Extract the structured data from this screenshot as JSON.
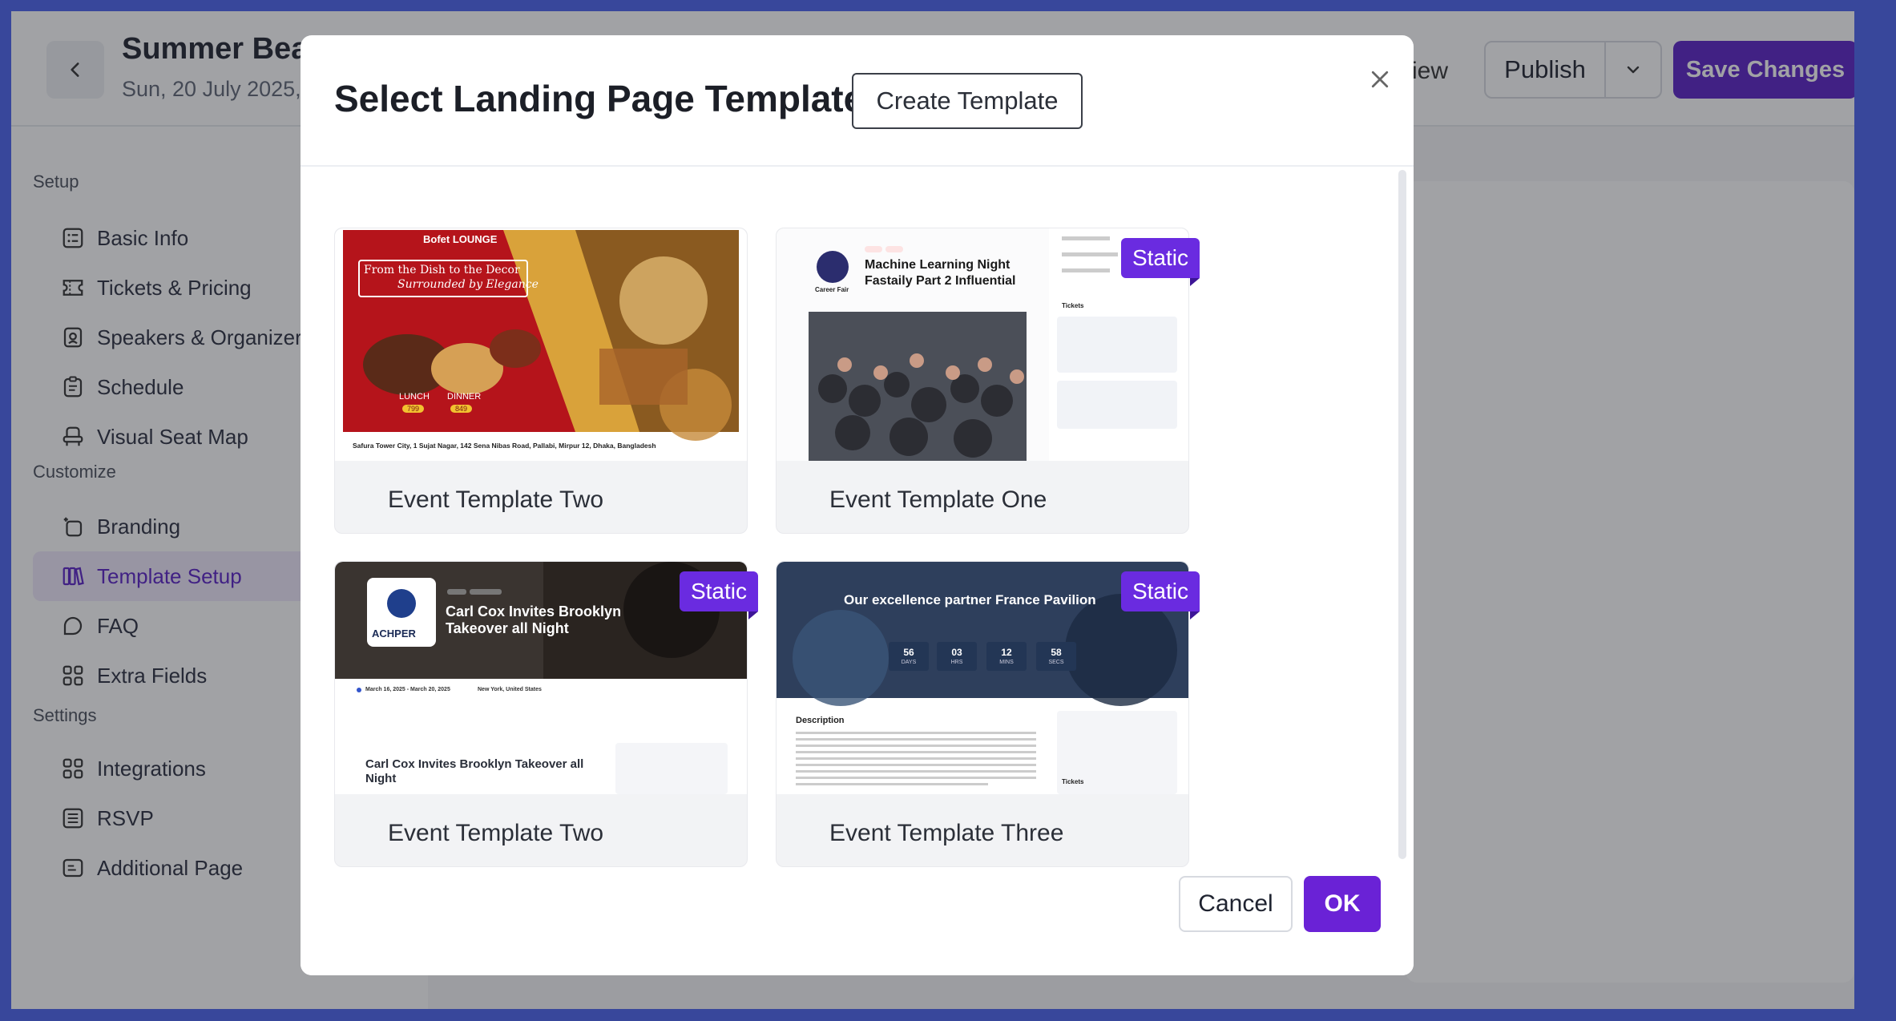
{
  "header": {
    "event_title": "Summer Bea",
    "event_date": "Sun, 20 July 2025,",
    "preview_label": "iew",
    "publish_label": "Publish",
    "save_label": "Save Changes"
  },
  "sidebar": {
    "sections": [
      {
        "label": "Setup",
        "items": [
          "Basic Info",
          "Tickets & Pricing",
          "Speakers & Organizers",
          "Schedule",
          "Visual Seat Map"
        ]
      },
      {
        "label": "Customize",
        "items": [
          "Branding",
          "Template Setup",
          "FAQ",
          "Extra Fields"
        ]
      },
      {
        "label": "Settings",
        "items": [
          "Integrations",
          "RSVP",
          "Additional Page"
        ]
      }
    ],
    "active_item": "Template Setup"
  },
  "modal": {
    "title": "Select Landing Page Template",
    "create_label": "Create Template",
    "cancel_label": "Cancel",
    "ok_label": "OK",
    "badge_label": "Static",
    "templates": [
      {
        "name": "Event Template Two",
        "static": false,
        "thumb": {
          "brand": "Bofet LOUNGE",
          "banner_line1": "From the Dish to the Decor",
          "banner_line2": "Surrounded by Elegance",
          "lunch": "LUNCH",
          "dinner": "DINNER",
          "lunch_price": "799",
          "dinner_price": "849",
          "address": "Safura Tower City, 1 Sujat Nagar, 142 Sena Nibas Road, Pallabi, Mirpur 12, Dhaka, Bangladesh"
        }
      },
      {
        "name": "Event Template One",
        "static": true,
        "thumb": {
          "heading": "Machine Learning Night Fastaily Part 2 Influential",
          "org": "Career Fair",
          "tickets": "Tickets"
        }
      },
      {
        "name": "Event Template Two",
        "static": true,
        "thumb": {
          "logo": "ACHPER",
          "heading": "Carl Cox Invites Brooklyn Takeover all Night",
          "dates": "March 16, 2025 - March 20, 2025",
          "location": "New York, United States",
          "subheading": "Carl Cox Invites Brooklyn Takeover all Night"
        }
      },
      {
        "name": "Event Template Three",
        "static": true,
        "thumb": {
          "heading": "Our excellence partner France Pavilion",
          "countdown": [
            {
              "value": "56",
              "unit": "DAYS"
            },
            {
              "value": "03",
              "unit": "HRS"
            },
            {
              "value": "12",
              "unit": "MINS"
            },
            {
              "value": "58",
              "unit": "SECS"
            }
          ],
          "description_title": "Description",
          "tickets": "Tickets"
        }
      }
    ]
  },
  "colors": {
    "brand_purple": "#5a22c7",
    "badge_purple": "#6a2be0",
    "frame_blue": "#4a63ee"
  }
}
